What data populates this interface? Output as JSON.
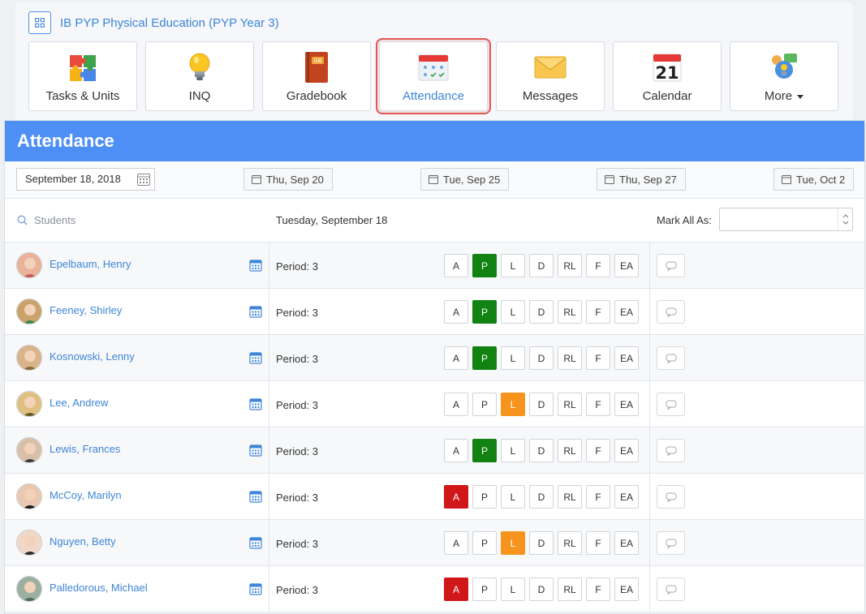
{
  "course": {
    "title": "IB PYP Physical Education (PYP Year 3)"
  },
  "nav": {
    "tiles": [
      {
        "label": "Tasks & Units",
        "icon": "puzzle-icon"
      },
      {
        "label": "INQ",
        "icon": "lightbulb-icon"
      },
      {
        "label": "Gradebook",
        "icon": "gradebook-icon"
      },
      {
        "label": "Attendance",
        "icon": "attendance-icon",
        "active": true
      },
      {
        "label": "Messages",
        "icon": "envelope-icon"
      },
      {
        "label": "Calendar",
        "icon": "calendar-icon",
        "day": "21"
      },
      {
        "label": "More",
        "icon": "more-icon"
      }
    ]
  },
  "attendance": {
    "title": "Attendance",
    "date_input": "September 18, 2018",
    "date_buttons": [
      "Thu, Sep 20",
      "Tue, Sep 25",
      "Thu, Sep 27",
      "Tue, Oct 2"
    ],
    "search_placeholder": "Students",
    "day_header": "Tuesday, September 18",
    "mark_all_label": "Mark All As:",
    "codes": [
      "A",
      "P",
      "L",
      "D",
      "RL",
      "F",
      "EA"
    ],
    "students": [
      {
        "name": "Epelbaum, Henry",
        "period": "Period: 3",
        "status": "P"
      },
      {
        "name": "Feeney, Shirley",
        "period": "Period: 3",
        "status": "P"
      },
      {
        "name": "Kosnowski, Lenny",
        "period": "Period: 3",
        "status": "P"
      },
      {
        "name": "Lee, Andrew",
        "period": "Period: 3",
        "status": "L"
      },
      {
        "name": "Lewis, Frances",
        "period": "Period: 3",
        "status": "P"
      },
      {
        "name": "McCoy, Marilyn",
        "period": "Period: 3",
        "status": "A"
      },
      {
        "name": "Nguyen, Betty",
        "period": "Period: 3",
        "status": "L"
      },
      {
        "name": "Palledorous, Michael",
        "period": "Period: 3",
        "status": "A"
      }
    ]
  },
  "colors": {
    "accent": "#4e8ff6",
    "link": "#3d85d8",
    "present": "#128212",
    "late": "#f7941d",
    "absent": "#d0181b"
  }
}
